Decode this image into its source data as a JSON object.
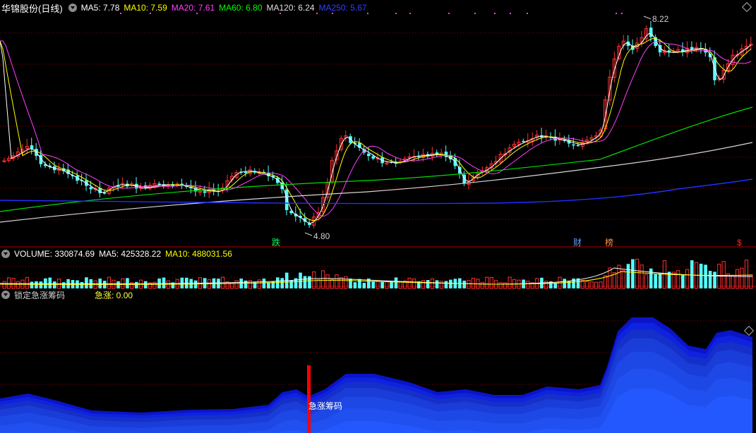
{
  "main": {
    "title": "华锦股份(日线)",
    "ma": [
      {
        "label": "MA5: 7.78",
        "color": "#ffffff"
      },
      {
        "label": "MA10: 7.59",
        "color": "#ffff00"
      },
      {
        "label": "MA20: 7.61",
        "color": "#ff40ff"
      },
      {
        "label": "MA60: 6.80",
        "color": "#00ff00"
      },
      {
        "label": "MA120: 6.24",
        "color": "#e0e0e0"
      },
      {
        "label": "MA250: 5.67",
        "color": "#3040ff"
      }
    ],
    "high_label": "8.22",
    "low_label": "4.80",
    "markers": {
      "die": "跌",
      "cai": "财",
      "bang": "榜",
      "dollar": "$"
    }
  },
  "volume": {
    "value": "VOLUME: 330874.69",
    "ma5": "MA5: 425328.22",
    "ma10": "MA10: 488031.56"
  },
  "indicator": {
    "title": "锁定急涨筹码",
    "value": "急涨: 0.00",
    "signal_label": "急涨筹码"
  },
  "colors": {
    "up": "#ff3030",
    "down": "#54ffff",
    "grid": "#a00000",
    "accent": "#ff0000"
  }
}
